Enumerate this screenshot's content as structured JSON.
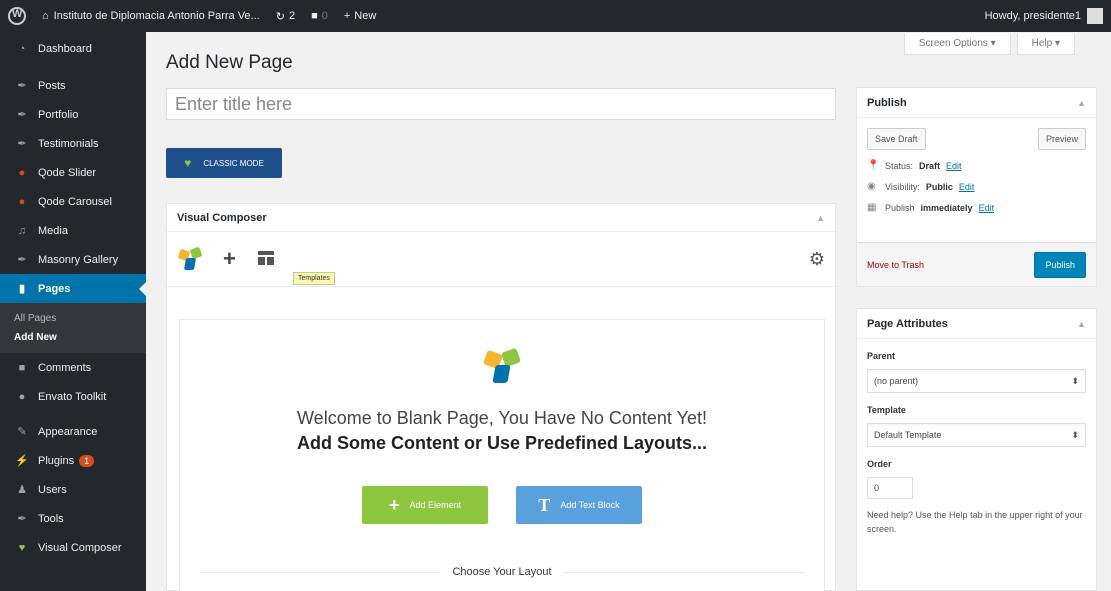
{
  "admin_bar": {
    "site_name": "Instituto de Diplomacia Antonio Parra Ve...",
    "comments_count": "2",
    "updates_count": "0",
    "new_label": "New",
    "howdy": "Howdy, presidente1"
  },
  "sidebar": {
    "items": [
      {
        "label": "Dashboard",
        "icon": "dashboard-icon"
      },
      {
        "label": "Posts",
        "icon": "pin-icon"
      },
      {
        "label": "Portfolio",
        "icon": "pin-icon"
      },
      {
        "label": "Testimonials",
        "icon": "pin-icon"
      },
      {
        "label": "Qode Slider",
        "icon": "slider-icon"
      },
      {
        "label": "Qode Carousel",
        "icon": "carousel-icon"
      },
      {
        "label": "Media",
        "icon": "media-icon"
      },
      {
        "label": "Masonry Gallery",
        "icon": "pin-icon"
      },
      {
        "label": "Pages",
        "icon": "pages-icon"
      },
      {
        "label": "Comments",
        "icon": "comments-icon"
      },
      {
        "label": "Envato Toolkit",
        "icon": "drop-icon"
      },
      {
        "label": "Appearance",
        "icon": "brush-icon"
      },
      {
        "label": "Plugins",
        "icon": "plugin-icon",
        "badge": "1"
      },
      {
        "label": "Users",
        "icon": "users-icon"
      },
      {
        "label": "Tools",
        "icon": "wrench-icon"
      },
      {
        "label": "Visual Composer",
        "icon": "vc-icon"
      }
    ],
    "submenu": [
      "All Pages",
      "Add New"
    ]
  },
  "header": {
    "screen_options": "Screen Options",
    "help": "Help",
    "page_title": "Add New Page",
    "title_placeholder": "Enter title here",
    "classic_mode": "CLASSIC MODE"
  },
  "vc": {
    "panel_title": "Visual Composer",
    "tooltip": "Templates",
    "welcome_line1": "Welcome to Blank Page, You Have No Content Yet!",
    "welcome_line2": "Add Some Content or Use Predefined Layouts...",
    "add_element": "Add Element",
    "add_text_block": "Add Text Block",
    "choose_layout": "Choose Your Layout"
  },
  "publish": {
    "title": "Publish",
    "save_draft": "Save Draft",
    "preview": "Preview",
    "status_label": "Status:",
    "status_value": "Draft",
    "visibility_label": "Visibility:",
    "visibility_value": "Public",
    "publish_label": "Publish",
    "publish_value": "immediately",
    "edit": "Edit",
    "move_to_trash": "Move to Trash",
    "publish_button": "Publish"
  },
  "page_attributes": {
    "title": "Page Attributes",
    "parent_label": "Parent",
    "parent_value": "(no parent)",
    "template_label": "Template",
    "template_value": "Default Template",
    "order_label": "Order",
    "order_value": "0",
    "help_text": "Need help? Use the Help tab in the upper right of your screen."
  },
  "colors": {
    "admin_bg": "#23282d",
    "accent": "#0073aa",
    "vc_green": "#8dc63f",
    "vc_blue": "#5aa0dc",
    "trash_red": "#a00"
  }
}
